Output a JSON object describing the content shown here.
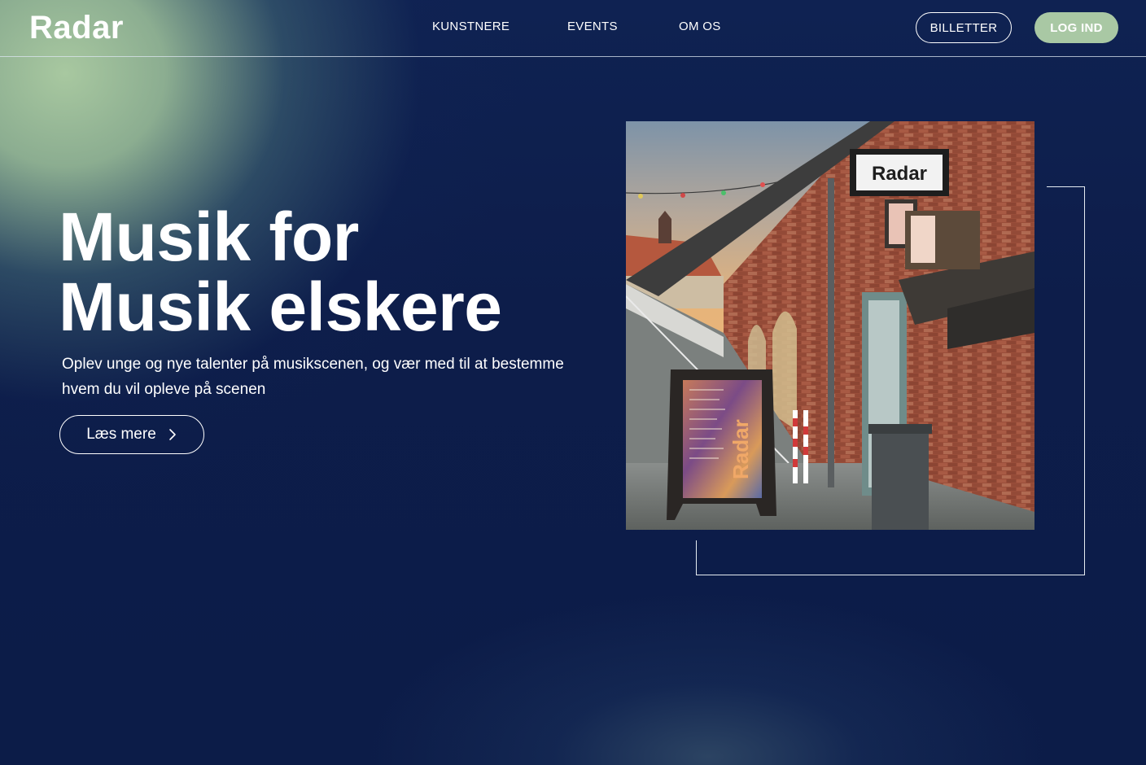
{
  "brand": {
    "logo_text": "Radar"
  },
  "nav": {
    "items": [
      {
        "label": "KUNSTNERE"
      },
      {
        "label": "EVENTS"
      },
      {
        "label": "OM OS"
      }
    ],
    "tickets_label": "BILLETTER",
    "login_label": "LOG IND"
  },
  "hero": {
    "title_line1": "Musik for",
    "title_line2": "Musik elskere",
    "subtitle_line1": "Oplev unge og nye talenter på musikscenen, og vær med til at bestemme",
    "subtitle_line2": "hvem du vil opleve på scenen",
    "cta_label": "Læs mere"
  },
  "photo": {
    "sign_text": "Radar",
    "board_text": "Radar"
  },
  "colors": {
    "background": "#0d1d4a",
    "accent_green": "#a9c8a4",
    "text": "#ffffff"
  },
  "icons": {
    "cta_icon": "chevron-right-icon"
  }
}
